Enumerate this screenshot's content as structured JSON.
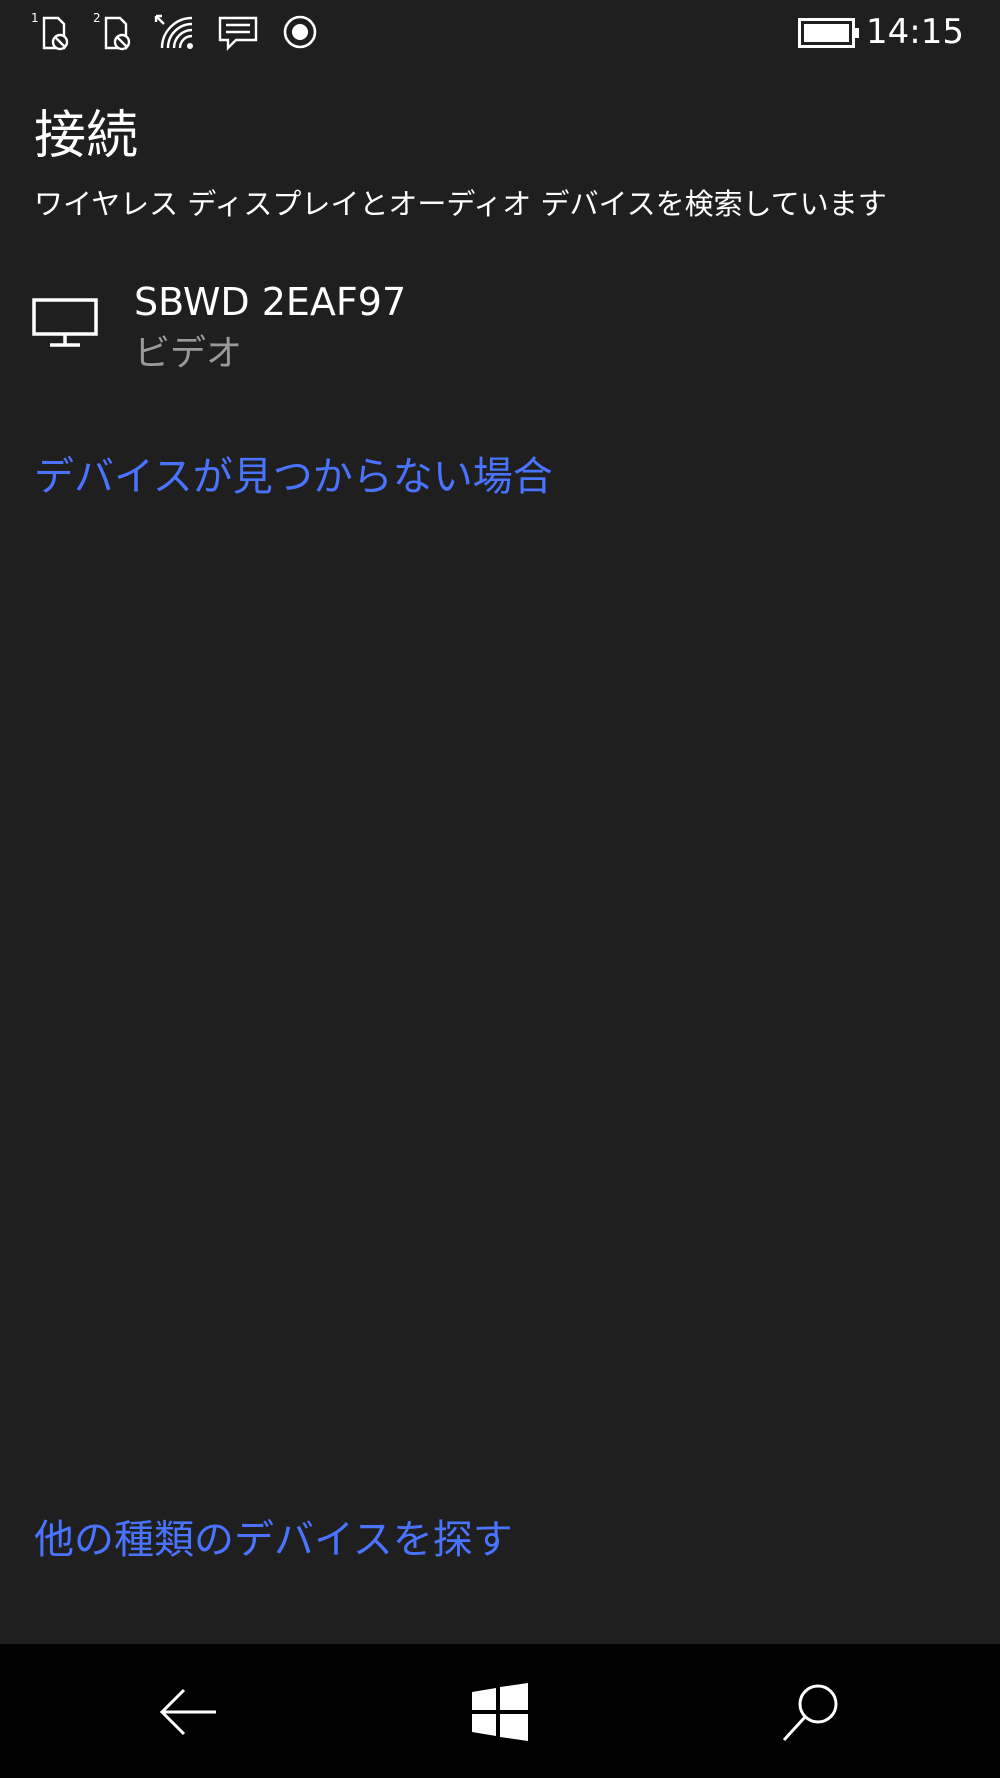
{
  "status_bar": {
    "sim1_label": "1",
    "sim2_label": "2",
    "icons": [
      "sim1-no-service-icon",
      "sim2-no-service-icon",
      "wifi-icon",
      "message-icon",
      "record-icon",
      "battery-icon"
    ],
    "time": "14:15"
  },
  "header": {
    "title": "接続",
    "subtitle": "ワイヤレス ディスプレイとオーディオ デバイスを検索しています"
  },
  "devices": [
    {
      "name": "SBWD 2EAF97",
      "type": "ビデオ",
      "icon": "monitor-icon"
    }
  ],
  "links": {
    "not_found": "デバイスが見つからない場合",
    "other_devices": "他の種類のデバイスを探す"
  },
  "nav": {
    "icons": [
      "back-arrow-icon",
      "windows-icon",
      "search-icon"
    ]
  },
  "colors": {
    "background": "#1f1f1f",
    "accent_link": "#4a74ff",
    "secondary_text": "#9a9a9a",
    "nav_background": "#000000"
  }
}
